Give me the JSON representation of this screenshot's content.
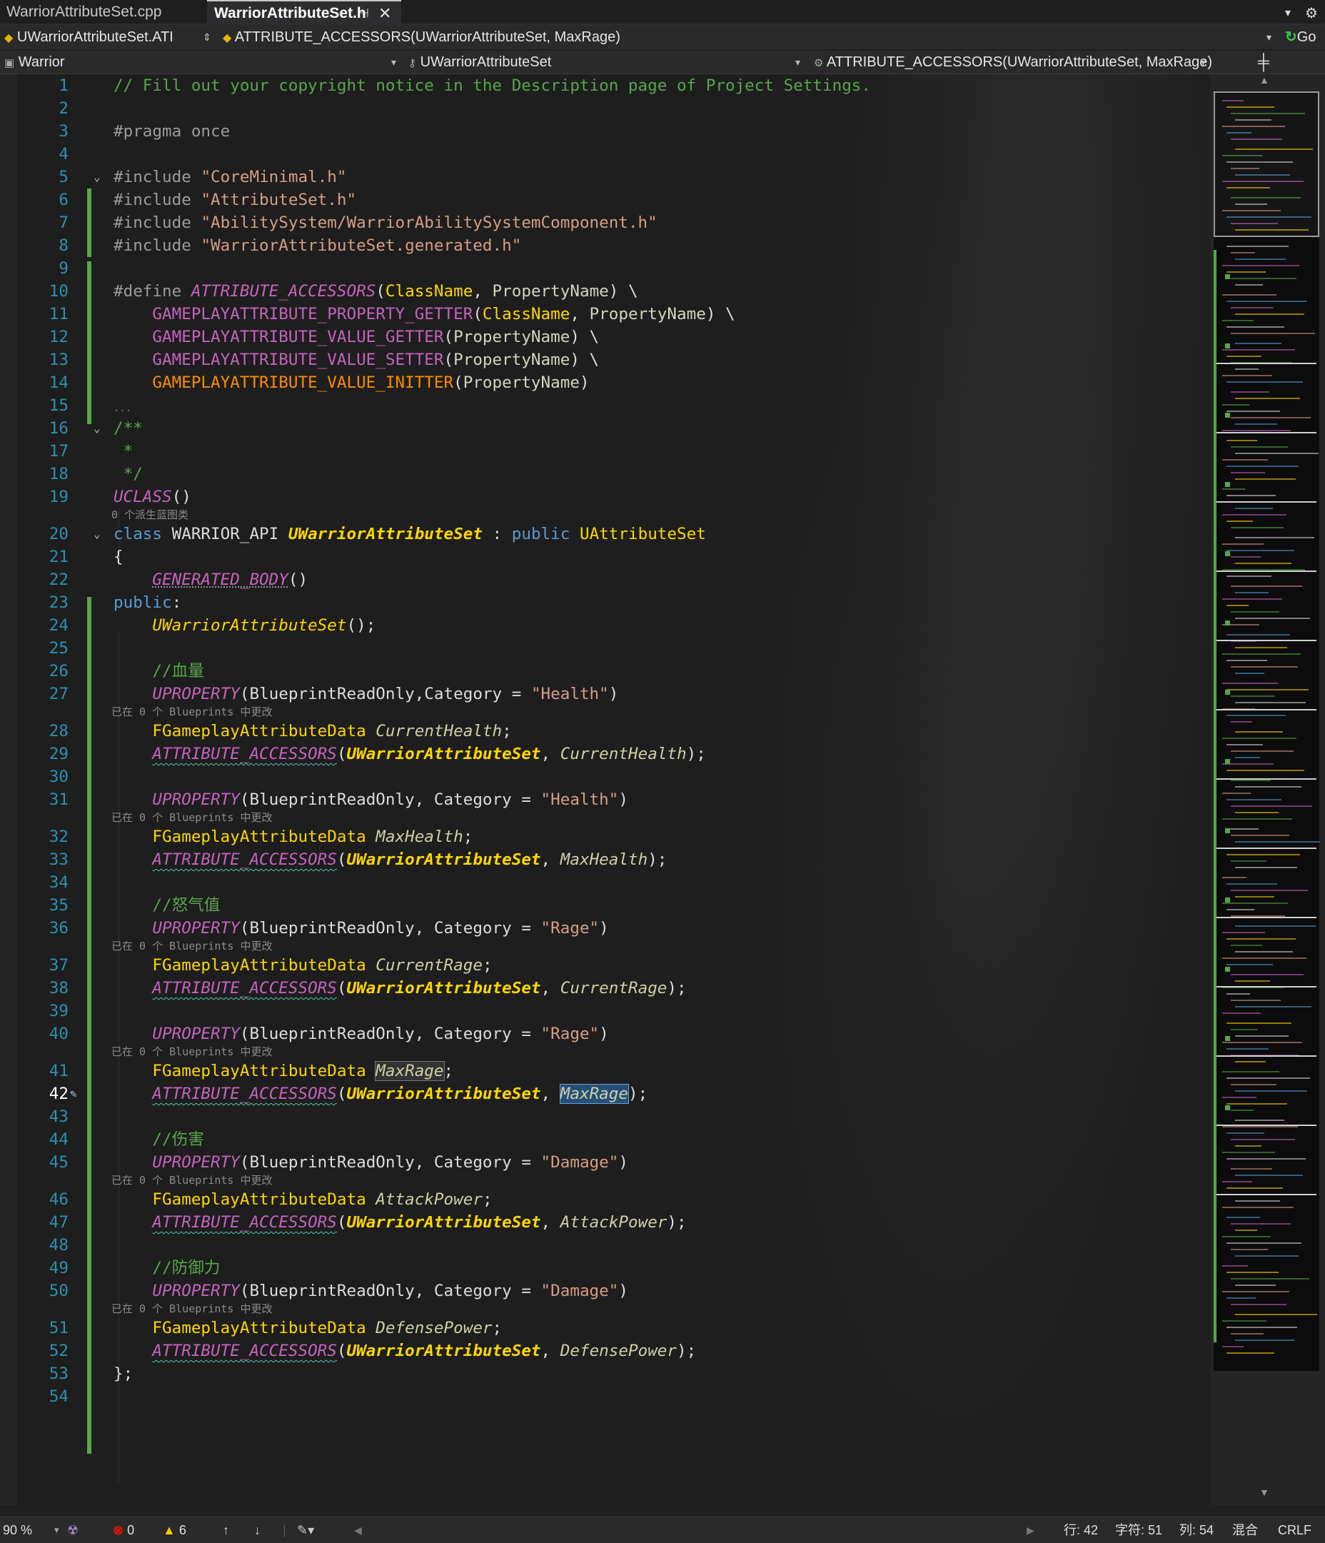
{
  "tabs": [
    {
      "label": "WarriorAttributeSet.cpp",
      "active": false
    },
    {
      "label": "WarriorAttributeSet.h",
      "active": true
    }
  ],
  "tab_icons": {
    "pin": "pin-icon",
    "close": "close-icon",
    "overflow": "chevron-down-icon",
    "settings": "gear-icon"
  },
  "nav": {
    "scope": "UWarriorAttributeSet.ATI",
    "member": "ATTRIBUTE_ACCESSORS(UWarriorAttributeSet, MaxRage)",
    "go_label": "Go"
  },
  "nav2": {
    "project": "Warrior",
    "class": "UWarriorAttributeSet",
    "member": "ATTRIBUTE_ACCESSORS(UWarriorAttributeSet, MaxRage)"
  },
  "code": {
    "line_numbers": [
      "1",
      "2",
      "3",
      "4",
      "5",
      "6",
      "7",
      "8",
      "9",
      "10",
      "11",
      "12",
      "13",
      "14",
      "15",
      "16",
      "17",
      "18",
      "19",
      "20",
      "21",
      "22",
      "23",
      "24",
      "25",
      "26",
      "27",
      "28",
      "29",
      "30",
      "31",
      "32",
      "33",
      "34",
      "35",
      "36",
      "37",
      "38",
      "39",
      "40",
      "41",
      "42",
      "43",
      "44",
      "45",
      "46",
      "47",
      "48",
      "49",
      "50",
      "51",
      "52",
      "53",
      "54"
    ],
    "current_line": "42",
    "hints": {
      "uclass": "0 个派生蓝图类",
      "uproperty": "已在 0 个 Blueprints 中更改"
    },
    "folded_marker": "..."
  },
  "status": {
    "zoom": "90 %",
    "errors": "0",
    "warnings": "6",
    "line": "行: 42",
    "char": "字符: 51",
    "col": "列: 54",
    "mixed": "混合",
    "eol": "CRLF"
  },
  "colors": {
    "comment": "#57a64a",
    "keyword": "#569cd6",
    "string": "#d69d85",
    "macro": "#c563bd",
    "type": "#ffd700",
    "line_number": "#2b91af",
    "change_bar": "#57a64a"
  }
}
